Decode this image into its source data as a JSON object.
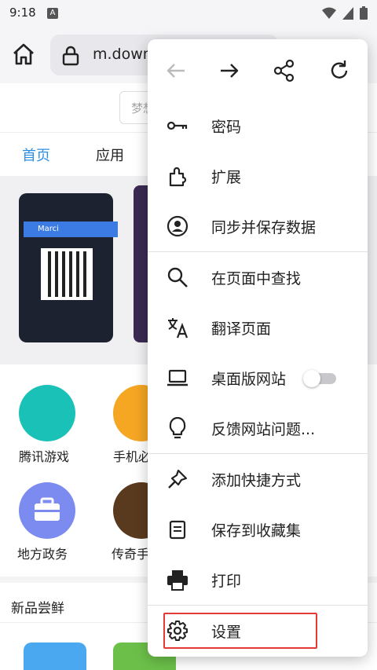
{
  "status_bar": {
    "time": "9:18",
    "notification_letter": "A"
  },
  "browser": {
    "url": "m.down"
  },
  "page": {
    "search_placeholder": "梦想",
    "tabs": {
      "home": "首页",
      "apps": "应用"
    },
    "banner_name": "Marci",
    "apps": [
      "腾讯游戏",
      "手机必",
      "地方政务",
      "传奇手"
    ],
    "section_title": "新品尝鲜"
  },
  "menu": {
    "items": [
      {
        "label": "密码",
        "icon": "key-icon"
      },
      {
        "label": "扩展",
        "icon": "puzzle-icon"
      },
      {
        "label": "同步并保存数据",
        "icon": "account-icon"
      },
      {
        "label": "在页面中查找",
        "icon": "search-icon"
      },
      {
        "label": "翻译页面",
        "icon": "translate-icon"
      },
      {
        "label": "桌面版网站",
        "icon": "laptop-icon"
      },
      {
        "label": "反馈网站问题...",
        "icon": "lightbulb-icon"
      },
      {
        "label": "添加快捷方式",
        "icon": "pin-icon"
      },
      {
        "label": "保存到收藏集",
        "icon": "collection-icon"
      },
      {
        "label": "打印",
        "icon": "printer-icon"
      },
      {
        "label": "设置",
        "icon": "gear-icon"
      }
    ],
    "desktop_site_enabled": false
  },
  "colors": {
    "accent": "#2b8fe6",
    "highlight": "#e53935"
  }
}
